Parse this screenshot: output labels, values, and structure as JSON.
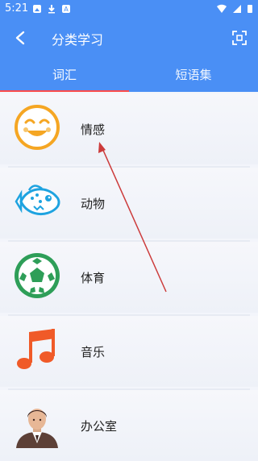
{
  "status_bar": {
    "time": "5:21"
  },
  "app_bar": {
    "title": "分类学习"
  },
  "tabs": [
    {
      "label": "词汇"
    },
    {
      "label": "短语集"
    }
  ],
  "categories": [
    {
      "label": "情感",
      "icon": "smiley-face-icon"
    },
    {
      "label": "动物",
      "icon": "fish-icon"
    },
    {
      "label": "体育",
      "icon": "soccer-ball-icon"
    },
    {
      "label": "音乐",
      "icon": "music-note-icon"
    },
    {
      "label": "办公室",
      "icon": "office-worker-icon"
    }
  ],
  "colors": {
    "primary": "#4a8ff5",
    "tab_indicator": "#ff4b4b",
    "arrow": "#cc3b3b"
  }
}
